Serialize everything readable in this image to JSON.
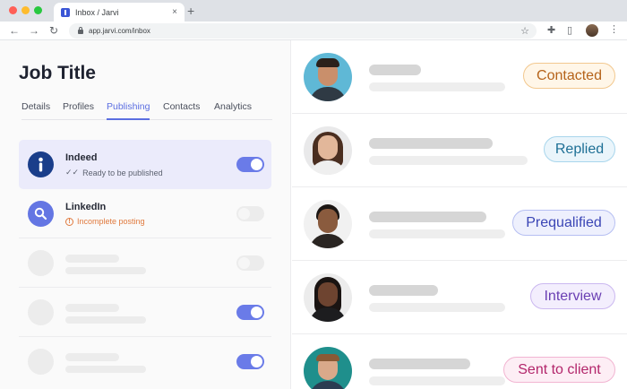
{
  "browser": {
    "tab_title": "Inbox / Jarvi",
    "tab_close": "×",
    "new_tab": "+",
    "back": "←",
    "forward": "→",
    "reload": "↻",
    "url": "app.jarvi.com/inbox",
    "star": "☆",
    "extensions": "✚",
    "sidepanel": "▯",
    "menu": "⋮"
  },
  "job": {
    "title": "Job Title",
    "tabs": [
      "Details",
      "Profiles",
      "Publishing",
      "Contacts",
      "Analytics"
    ],
    "active_tab": "Publishing"
  },
  "job_boards": [
    {
      "name": "Indeed",
      "status": "Ready to be published",
      "status_icon": "✓✓",
      "icon": "indeed-icon",
      "enabled": true,
      "selected": true
    },
    {
      "name": "LinkedIn",
      "status": "Incomplete posting",
      "status_icon": "!",
      "icon": "search-icon",
      "enabled": false,
      "selected": false
    },
    {
      "placeholder": true,
      "enabled": false
    },
    {
      "placeholder": true,
      "enabled": true
    },
    {
      "placeholder": true,
      "enabled": true
    }
  ],
  "candidates": [
    {
      "status": "Contacted",
      "colors": {
        "text": "#b5631a",
        "bg": "#fff6e8",
        "border": "#f2c88f"
      }
    },
    {
      "status": "Replied",
      "colors": {
        "text": "#1d6f95",
        "bg": "#eaf5fb",
        "border": "#a9d6ec"
      }
    },
    {
      "status": "Prequalified",
      "colors": {
        "text": "#3a45b5",
        "bg": "#eef0fd",
        "border": "#b6bff2"
      }
    },
    {
      "status": "Interview",
      "colors": {
        "text": "#6a3fb3",
        "bg": "#f3eefd",
        "border": "#cbb8f0"
      }
    },
    {
      "status": "Sent to client",
      "colors": {
        "text": "#b3266b",
        "bg": "#fdeef5",
        "border": "#f2b5d2"
      }
    }
  ],
  "colors": {
    "accent": "#5b6ee1",
    "toggle_on": "#6a7be8",
    "indeed": "#1a3e8a",
    "linkedin": "#6476e3",
    "warning": "#e0793d"
  }
}
